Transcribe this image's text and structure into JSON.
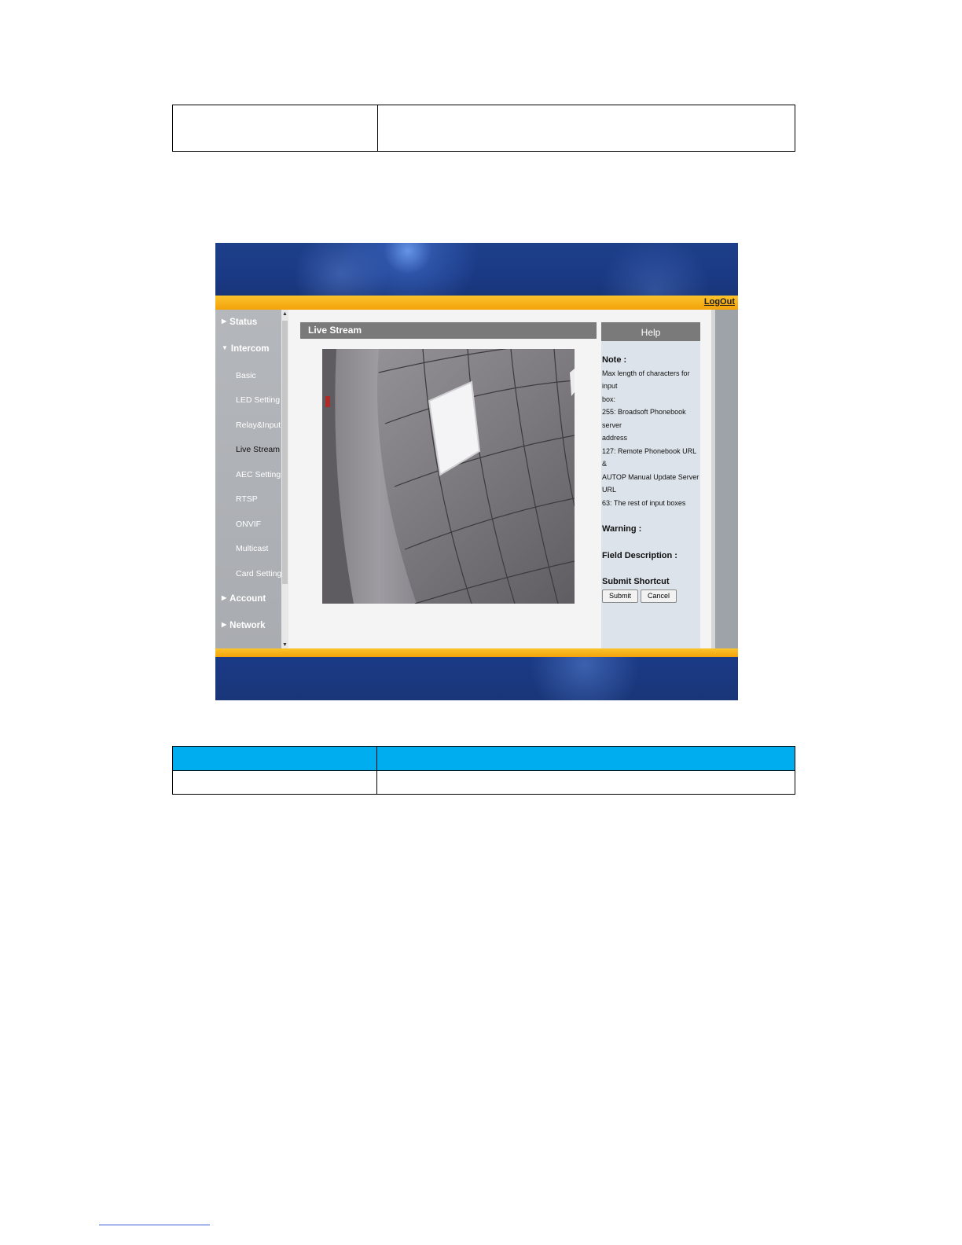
{
  "header": {
    "logout_label": "LogOut"
  },
  "sidebar": {
    "items": [
      {
        "label": "Status",
        "type": "top",
        "expanded": false
      },
      {
        "label": "Intercom",
        "type": "top",
        "expanded": true
      },
      {
        "label": "Basic",
        "type": "sub"
      },
      {
        "label": "LED Setting",
        "type": "sub"
      },
      {
        "label": "Relay&Input",
        "type": "sub"
      },
      {
        "label": "Live Stream",
        "type": "sub",
        "active": true
      },
      {
        "label": "AEC Setting",
        "type": "sub"
      },
      {
        "label": "RTSP",
        "type": "sub"
      },
      {
        "label": "ONVIF",
        "type": "sub"
      },
      {
        "label": "Multicast",
        "type": "sub"
      },
      {
        "label": "Card Setting",
        "type": "sub"
      },
      {
        "label": "Account",
        "type": "top",
        "expanded": false
      },
      {
        "label": "Network",
        "type": "top",
        "expanded": false
      }
    ]
  },
  "main": {
    "title": "Live Stream"
  },
  "help": {
    "title": "Help",
    "note_heading": "Note :",
    "note_lines": [
      "Max length of characters for input",
      "box:",
      "255: Broadsoft Phonebook server",
      "address",
      "127: Remote Phonebook URL &",
      "AUTOP Manual Update Server URL",
      "63: The rest of input boxes"
    ],
    "warning_heading": "Warning :",
    "field_heading": "Field Description :",
    "submit_heading": "Submit Shortcut",
    "submit_label": "Submit",
    "cancel_label": "Cancel"
  },
  "colors": {
    "banner_blue": "#1b3a86",
    "orange_bar": "#f5a614",
    "table_header_blue": "#00aeef",
    "sidebar_grey": "#aeb1b5"
  }
}
